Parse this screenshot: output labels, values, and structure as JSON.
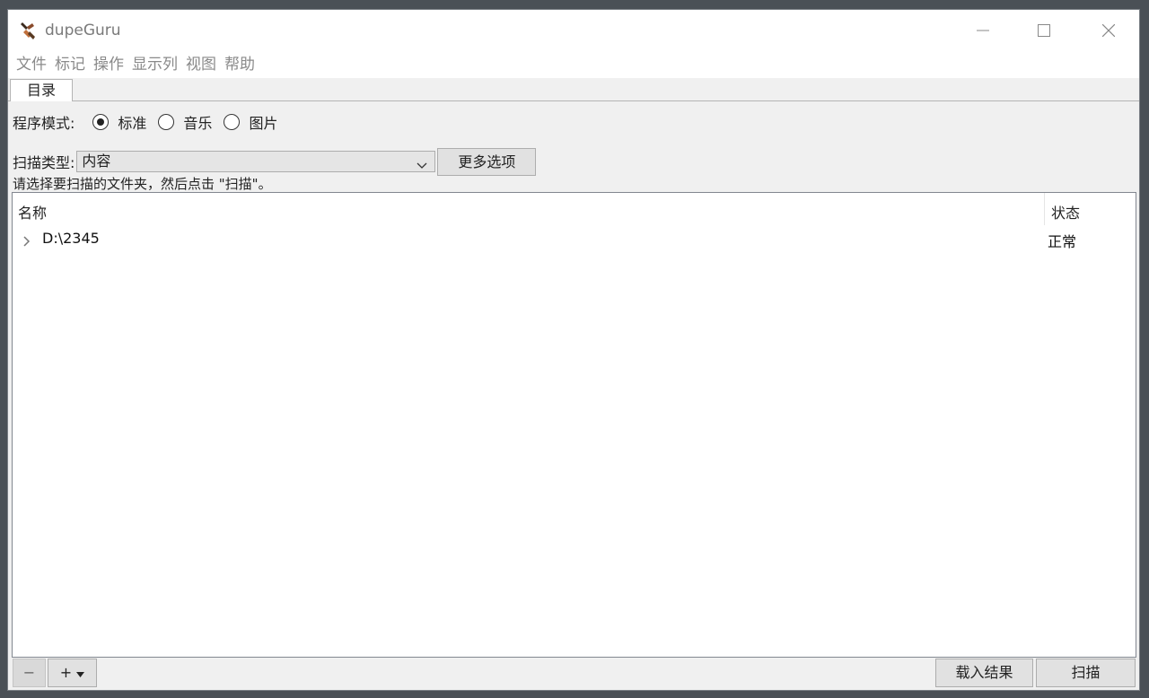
{
  "window": {
    "title": "dupeGuru"
  },
  "menu": {
    "items": [
      "文件",
      "标记",
      "操作",
      "显示列",
      "视图",
      "帮助"
    ]
  },
  "tabs": [
    {
      "label": "目录",
      "active": true
    }
  ],
  "app_mode": {
    "label": "程序模式:",
    "options": [
      {
        "label": "标准",
        "selected": true
      },
      {
        "label": "音乐",
        "selected": false
      },
      {
        "label": "图片",
        "selected": false
      }
    ]
  },
  "scan_type": {
    "label": "扫描类型:",
    "selected": "内容",
    "more_options_label": "更多选项"
  },
  "hint": "请选择要扫描的文件夹，然后点击 \"扫描\"。",
  "directories": {
    "columns": [
      "名称",
      "状态"
    ],
    "rows": [
      {
        "name": "D:\\2345",
        "status": "正常"
      }
    ]
  },
  "bottom": {
    "remove_label": "−",
    "add_label": "+",
    "load_results_label": "载入结果",
    "scan_label": "扫描"
  },
  "icons": {
    "app": "dupeguru-app-icon",
    "minimize": "minimize-icon",
    "maximize": "maximize-icon",
    "close": "close-icon",
    "dropdown": "chevron-down-icon",
    "expand": "chevron-right-icon",
    "add_dropdown": "caret-down-icon"
  },
  "colors": {
    "window_bg": "#f0f0f0",
    "titlebar_bg": "#ffffff",
    "menu_text": "#8a8a8a",
    "desktop_bg": "#4a5056"
  }
}
